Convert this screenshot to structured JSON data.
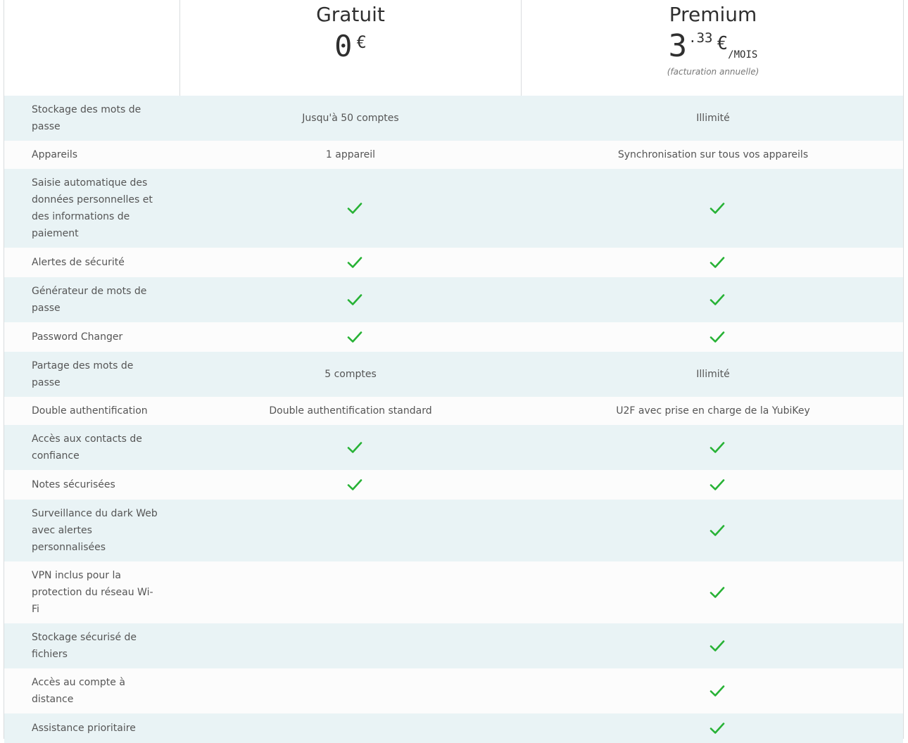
{
  "plans": {
    "free": {
      "name": "Gratuit",
      "price_main": "0",
      "currency": "€"
    },
    "premium": {
      "name": "Premium",
      "price_main": "3",
      "price_cents": ".33",
      "currency": "€",
      "per": "/MOIS",
      "billing_note": "(facturation annuelle)"
    }
  },
  "rows": [
    {
      "feature": "Stockage des mots de passe",
      "free": "Jusqu'à 50 comptes",
      "premium": "Illimité",
      "h": 64,
      "shade": true
    },
    {
      "feature": "Appareils",
      "free": "1 appareil",
      "premium": "Synchronisation sur tous vos appareils",
      "h": 40,
      "shade": false
    },
    {
      "feature": "Saisie automatique des données personnelles et des informations de paiement",
      "free": "check",
      "premium": "check",
      "h": 112,
      "shade": true
    },
    {
      "feature": "Alertes de sécurité",
      "free": "check",
      "premium": "check",
      "h": 42,
      "shade": false
    },
    {
      "feature": "Générateur de mots de passe",
      "free": "check",
      "premium": "check",
      "h": 64,
      "shade": true
    },
    {
      "feature": "Password Changer",
      "free": "check",
      "premium": "check",
      "h": 42,
      "shade": false
    },
    {
      "feature": "Partage des mots de passe",
      "free": "5 comptes",
      "premium": "Illimité",
      "h": 64,
      "shade": true
    },
    {
      "feature": "Double authentification",
      "free": "Double authentification standard",
      "premium": "U2F avec prise en charge de la YubiKey",
      "h": 40,
      "shade": false
    },
    {
      "feature": "Accès aux contacts de confiance",
      "free": "check",
      "premium": "check",
      "h": 64,
      "shade": true
    },
    {
      "feature": "Notes sécurisées",
      "free": "check",
      "premium": "check",
      "h": 42,
      "shade": false
    },
    {
      "feature": "Surveillance du dark Web avec alertes personnalisées",
      "free": "",
      "premium": "check",
      "h": 88,
      "shade": true
    },
    {
      "feature": "VPN inclus pour la protection du réseau Wi-Fi",
      "free": "",
      "premium": "check",
      "h": 88,
      "shade": false
    },
    {
      "feature": "Stockage sécurisé de fichiers",
      "free": "",
      "premium": "check",
      "h": 64,
      "shade": true
    },
    {
      "feature": "Accès au compte à distance",
      "free": "",
      "premium": "check",
      "h": 64,
      "shade": false
    },
    {
      "feature": "Assistance prioritaire",
      "free": "",
      "premium": "check",
      "h": 42,
      "shade": true
    }
  ],
  "colors": {
    "check": "#27b235",
    "row_shade": "#e9f3f5"
  },
  "icons": {
    "included": "check-icon"
  }
}
